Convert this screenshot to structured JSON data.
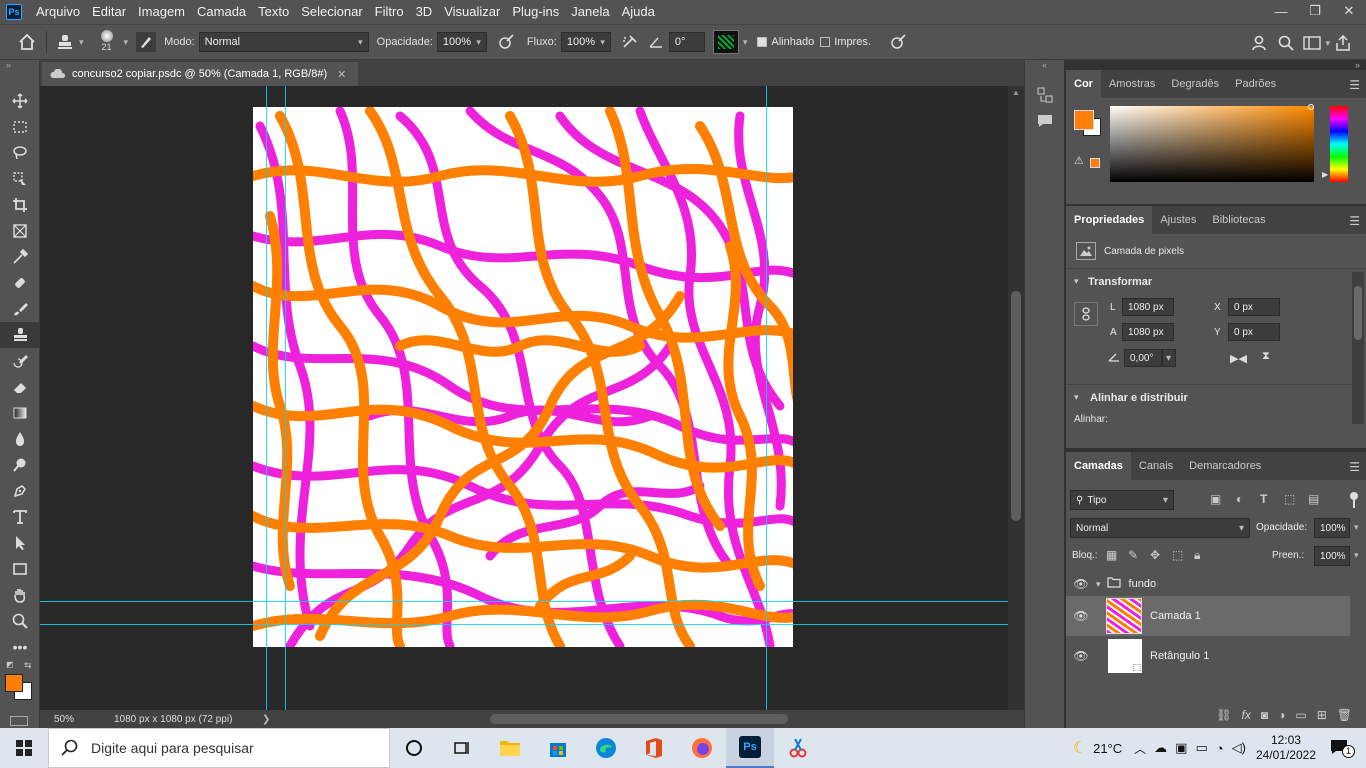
{
  "menubar": {
    "logo": "Ps",
    "items": [
      "Arquivo",
      "Editar",
      "Imagem",
      "Camada",
      "Texto",
      "Selecionar",
      "Filtro",
      "3D",
      "Visualizar",
      "Plug-ins",
      "Janela",
      "Ajuda"
    ],
    "minimize": "—",
    "restore": "❐",
    "close": "✕"
  },
  "options": {
    "brush_size": "21",
    "mode_label": "Modo:",
    "mode_value": "Normal",
    "opacity_label": "Opacidade:",
    "opacity_value": "100%",
    "flow_label": "Fluxo:",
    "flow_value": "100%",
    "angle_value": "0°",
    "aligned_label": "Alinhado",
    "aligned_checked": true,
    "sample_label": "Impres.",
    "sample_checked": false
  },
  "document": {
    "tab_title": "concurso2 copiar.psdc @ 50% (Camada 1, RGB/8#)",
    "tab_close": "✕",
    "zoom": "50%",
    "doc_info": "1080 px x 1080 px (72 ppi)",
    "status_arrow": "❯"
  },
  "color_panel": {
    "tabs": [
      "Cor",
      "Amostras",
      "Degradês",
      "Padrões"
    ],
    "foreground": "#ff7f0a",
    "background": "#ffffff"
  },
  "properties_panel": {
    "tabs": [
      "Propriedades",
      "Ajustes",
      "Bibliotecas"
    ],
    "layer_type": "Camada de pixels",
    "transform_title": "Transformar",
    "w_label": "L",
    "w_value": "1080 px",
    "h_label": "A",
    "h_value": "1080 px",
    "x_label": "X",
    "x_value": "0 px",
    "y_label": "Y",
    "y_value": "0 px",
    "angle_value": "0,00°",
    "align_title": "Alinhar e distribuir",
    "align_label": "Alinhar:"
  },
  "layers_panel": {
    "tabs": [
      "Camadas",
      "Canais",
      "Demarcadores"
    ],
    "filter_value": "Tipo",
    "blend_mode": "Normal",
    "opacity_label": "Opacidade:",
    "opacity_value": "100%",
    "lock_label": "Bloq.:",
    "fill_label": "Preen.:",
    "fill_value": "100%",
    "layers": [
      {
        "name": "fundo",
        "type": "group",
        "visible": true,
        "selected": false
      },
      {
        "name": "Camada 1",
        "type": "pixel",
        "visible": true,
        "selected": true
      },
      {
        "name": "Retângulo 1",
        "type": "shape",
        "visible": true,
        "selected": false
      }
    ]
  },
  "taskbar": {
    "search_placeholder": "Digite aqui para pesquisar",
    "weather": "21°C",
    "time": "12:03",
    "date": "24/01/2022",
    "notification_count": "1"
  }
}
